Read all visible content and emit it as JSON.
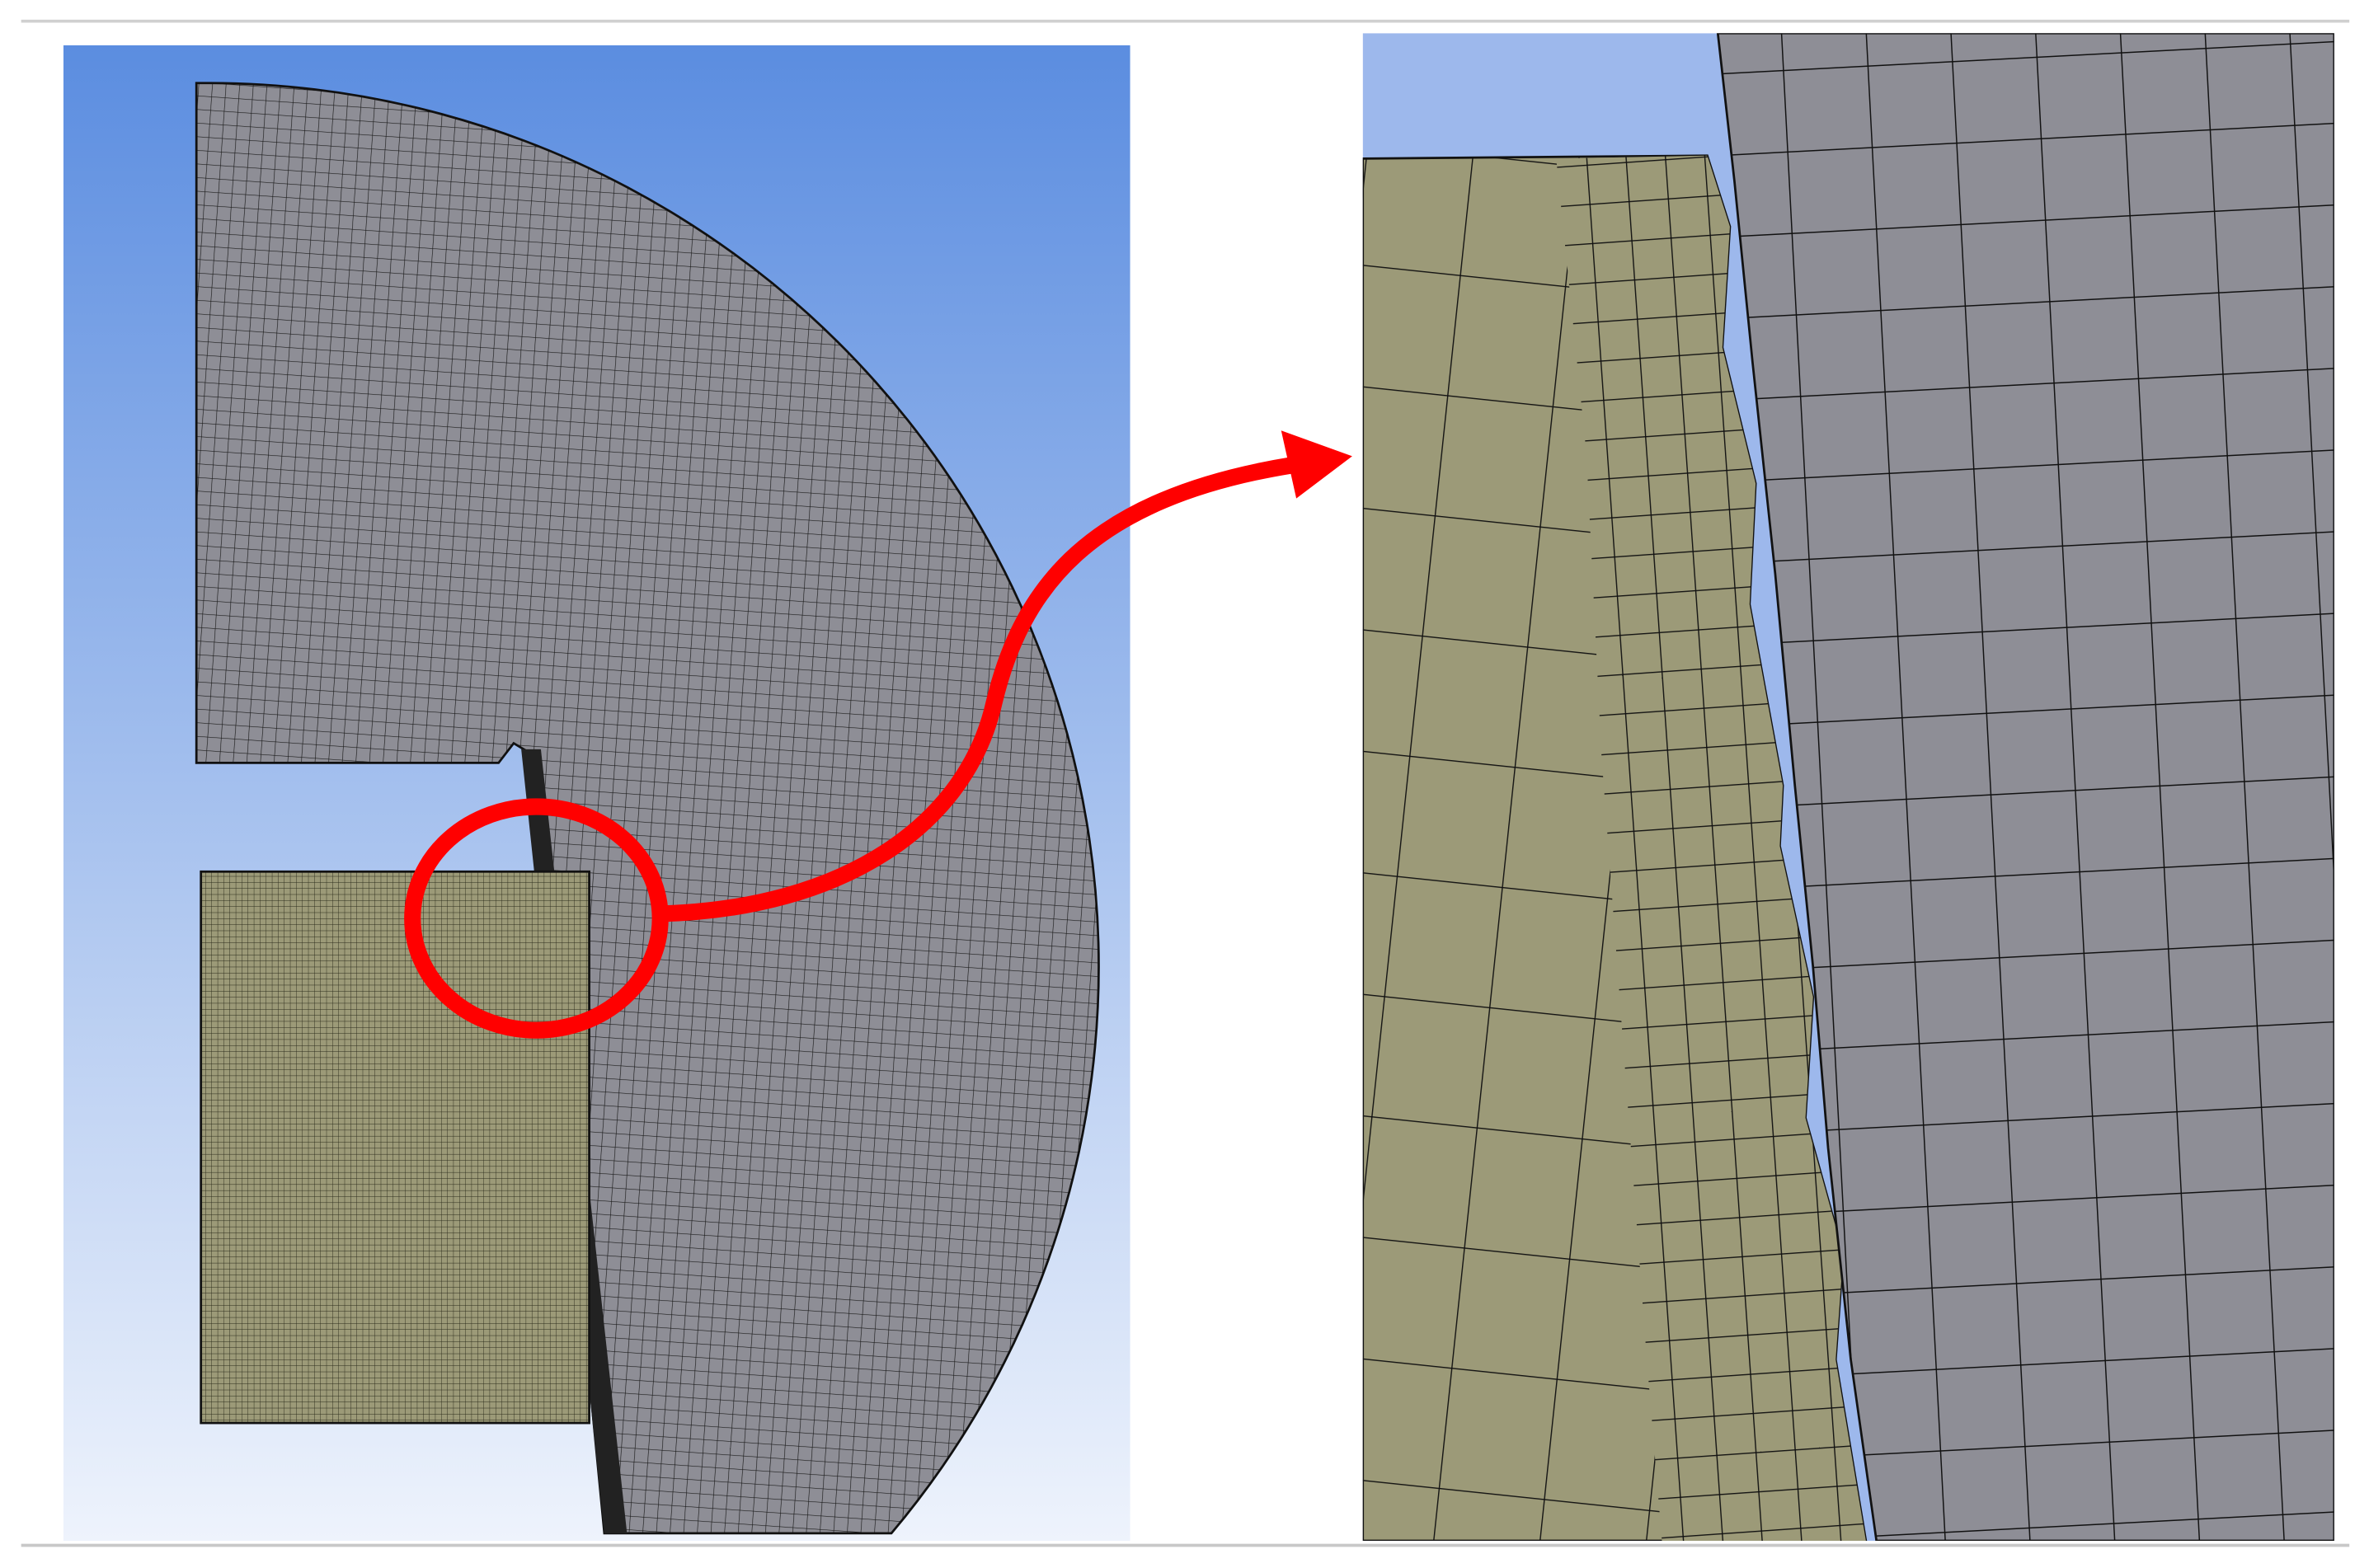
{
  "figure": {
    "kind": "finite-element mesh comparison with zoomed detail",
    "colors": {
      "background_top": "#5b8de0",
      "background_bottom": "#eef3fc",
      "zoom_background": "#9db8ec",
      "gray_mesh_fill": "#8e8e96",
      "olive_mesh_fill": "#9c9a78",
      "mesh_line": "#111111",
      "highlight": "#ff0000",
      "frame_line": "#cccccc"
    }
  }
}
